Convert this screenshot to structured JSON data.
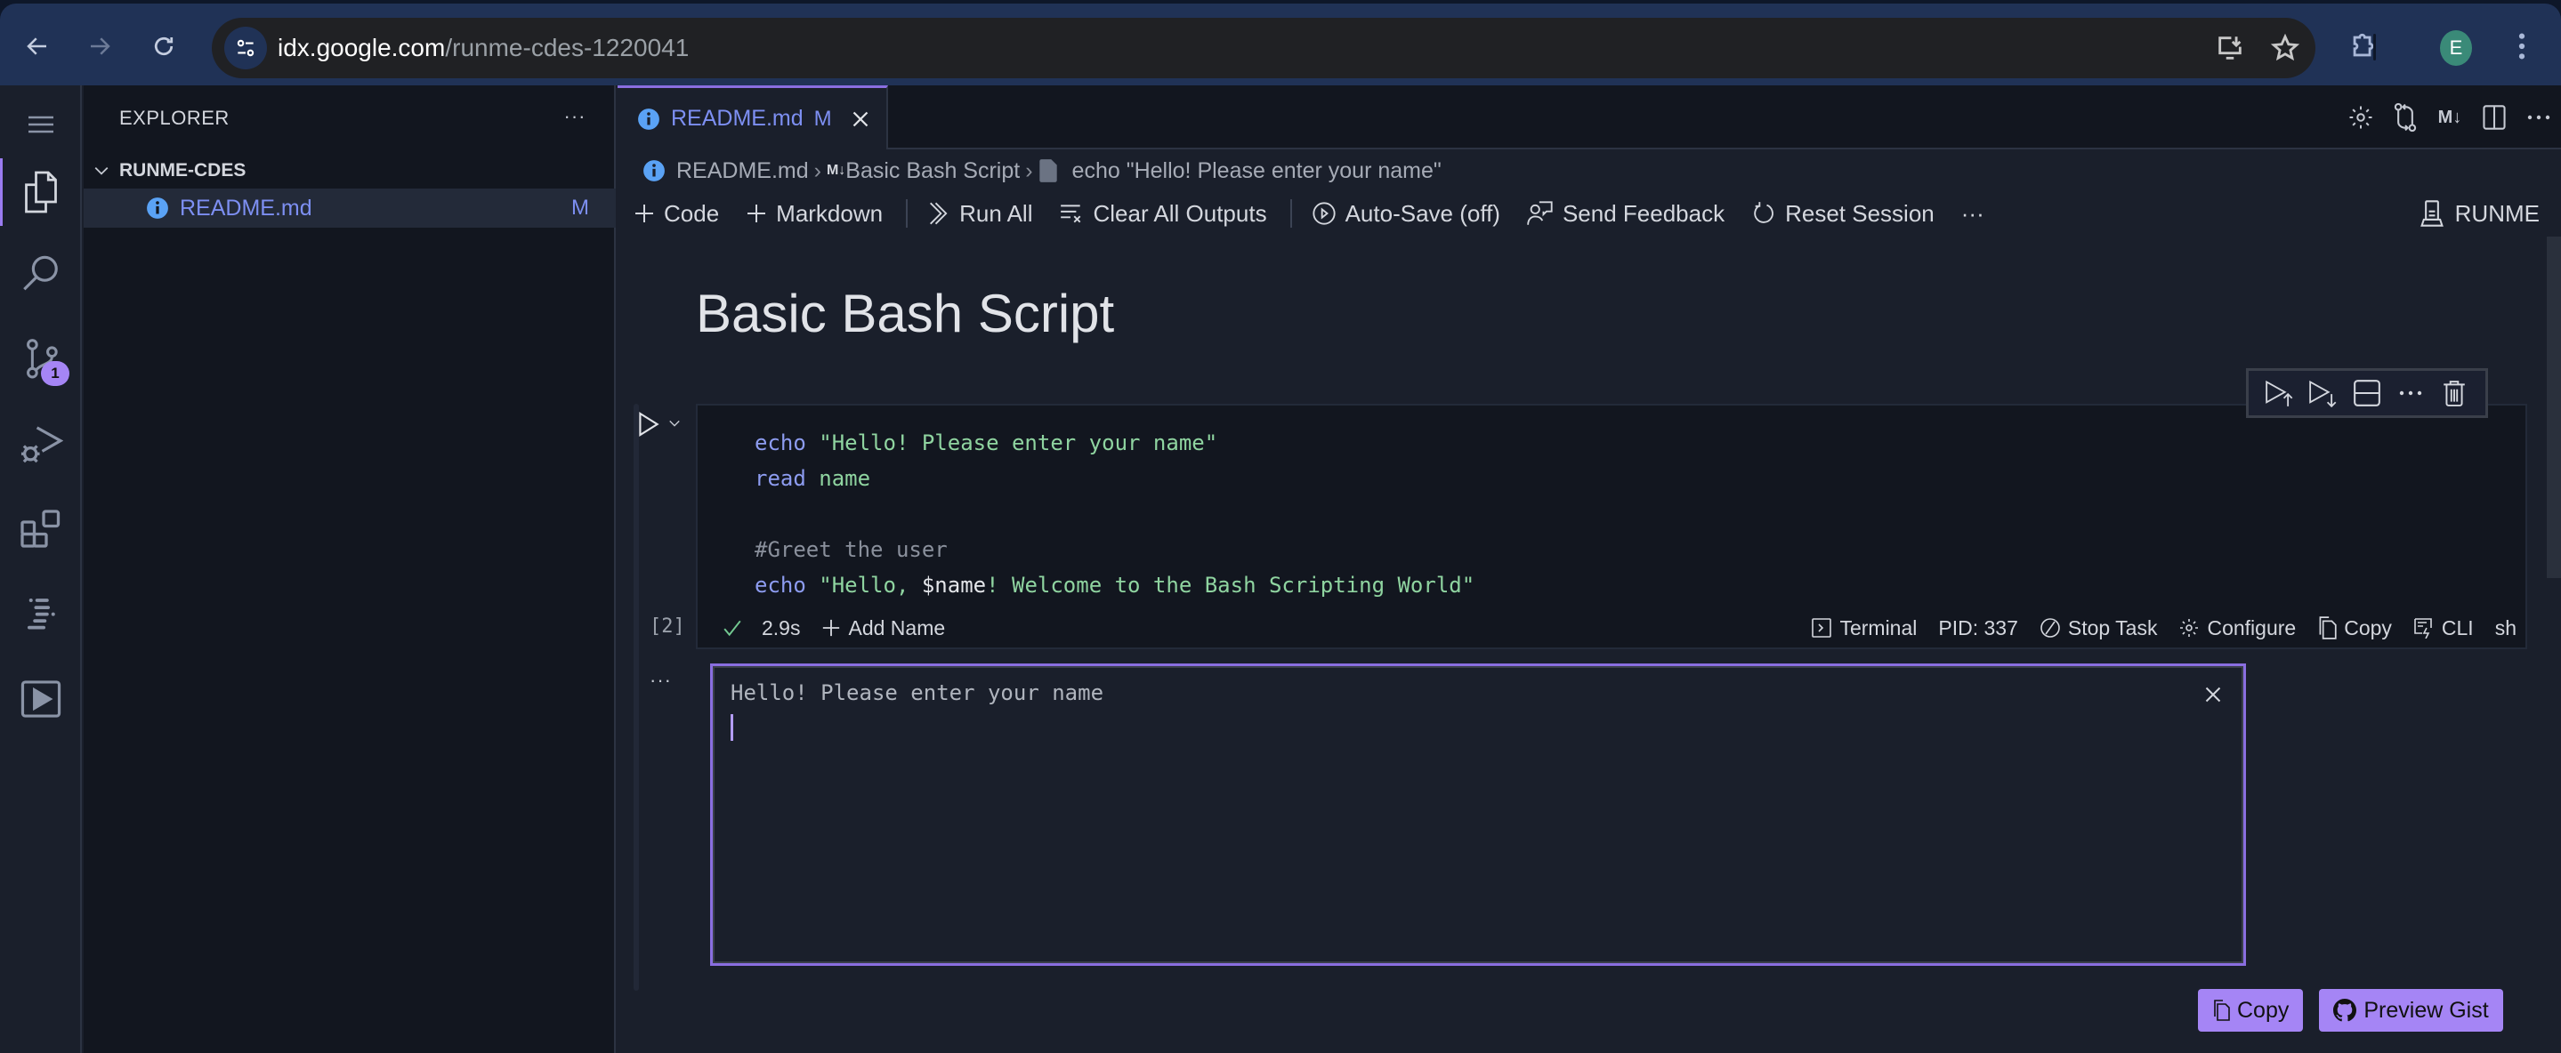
{
  "browser": {
    "url_host": "idx.google.com",
    "url_path": "/runme-cdes-1220041",
    "profile_initial": "E",
    "colors": {
      "frame": "#203256",
      "omnibox": "#202124",
      "avatar": "#3a8a78"
    }
  },
  "activity_bar": {
    "items": [
      {
        "name": "menu",
        "icon": "hamburger-icon"
      },
      {
        "name": "explorer",
        "icon": "files-icon",
        "active": true
      },
      {
        "name": "search",
        "icon": "search-icon"
      },
      {
        "name": "source-control",
        "icon": "source-control-icon",
        "badge": "1"
      },
      {
        "name": "run-debug",
        "icon": "run-debug-icon"
      },
      {
        "name": "extensions",
        "icon": "extensions-icon"
      },
      {
        "name": "outline",
        "icon": "outline-icon"
      },
      {
        "name": "runme",
        "icon": "play-box-icon"
      }
    ]
  },
  "sidebar": {
    "title": "EXPLORER",
    "more_label": "···",
    "folder": {
      "name": "RUNME-CDES"
    },
    "files": [
      {
        "name": "README.md",
        "status": "M"
      }
    ]
  },
  "editor": {
    "tab": {
      "label": "README.md",
      "status": "M"
    },
    "breadcrumb": {
      "file": "README.md",
      "section_prefix": "M↓",
      "section": "Basic Bash Script",
      "cell": "echo \"Hello! Please enter your name\""
    },
    "toolbar": {
      "code": "Code",
      "markdown": "Markdown",
      "run_all": "Run All",
      "clear_outputs": "Clear All Outputs",
      "auto_save": "Auto-Save (off)",
      "send_feedback": "Send Feedback",
      "reset_session": "Reset Session",
      "more": "···",
      "kernel": "RUNME"
    },
    "heading": "Basic Bash Script",
    "cell": {
      "execution_count": "[2]",
      "lines": [
        [
          {
            "t": "kw",
            "v": "echo"
          },
          {
            "t": "str",
            "v": " \"Hello! Please enter your name\""
          }
        ],
        [
          {
            "t": "kw",
            "v": "read"
          },
          {
            "t": "plain",
            "v": " name"
          }
        ],
        [],
        [
          {
            "t": "cmt",
            "v": "#Greet the user"
          }
        ],
        [
          {
            "t": "kw",
            "v": "echo"
          },
          {
            "t": "str",
            "v": " \"Hello, "
          },
          {
            "t": "var",
            "v": "$name"
          },
          {
            "t": "str",
            "v": "! Welcome to the Bash Scripting World\""
          }
        ]
      ],
      "status": {
        "duration": "2.9s",
        "add_name": "Add Name",
        "terminal": "Terminal",
        "pid": "PID: 337",
        "stop_task": "Stop Task",
        "configure": "Configure",
        "copy": "Copy",
        "cli": "CLI",
        "lang": "sh"
      }
    },
    "output": {
      "more": "···",
      "terminal_text": "Hello! Please enter your name",
      "copy_button": "Copy",
      "gist_button": "Preview Gist"
    },
    "colors": {
      "accent": "#a585f5",
      "border_accent": "#8a6ee0",
      "keyword": "#8d9cf0",
      "string": "#8fd4a0"
    }
  }
}
